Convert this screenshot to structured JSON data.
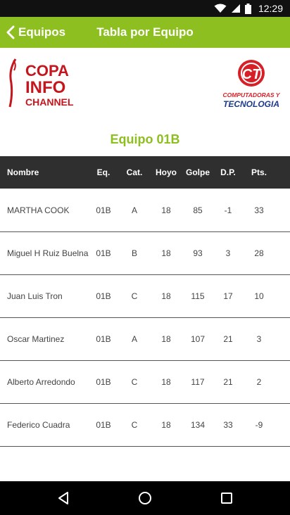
{
  "colors": {
    "accent": "#8cbf1f",
    "header_bg": "#2f2f2f",
    "status_bg": "#111111",
    "nav_bg": "#000000"
  },
  "statusbar": {
    "time": "12:29",
    "icons": [
      "wifi-icon",
      "signal-icon",
      "battery-icon"
    ]
  },
  "appbar": {
    "back_label": "Equipos",
    "title": "Tabla por Equipo"
  },
  "logos": {
    "left": {
      "lines": [
        "COPA",
        "INFO",
        "CHANNEL"
      ]
    },
    "right": {
      "mark": "CT",
      "lines": [
        "COMPUTADORAS Y",
        "TECNOLOGIA"
      ]
    }
  },
  "team_title": "Equipo 01B",
  "table": {
    "headers": {
      "name": "Nombre",
      "eq": "Eq.",
      "cat": "Cat.",
      "hoyo": "Hoyo",
      "golpe": "Golpe",
      "dp": "D.P.",
      "pts": "Pts."
    },
    "rows": [
      {
        "name": "MARTHA COOK",
        "eq": "01B",
        "cat": "A",
        "hoyo": "18",
        "golpe": "85",
        "dp": "-1",
        "pts": "33"
      },
      {
        "name": "Miguel H Ruiz Buelna",
        "eq": "01B",
        "cat": "B",
        "hoyo": "18",
        "golpe": "93",
        "dp": "3",
        "pts": "28"
      },
      {
        "name": "Juan Luis Tron",
        "eq": "01B",
        "cat": "C",
        "hoyo": "18",
        "golpe": "115",
        "dp": "17",
        "pts": "10"
      },
      {
        "name": "Oscar Martinez",
        "eq": "01B",
        "cat": "A",
        "hoyo": "18",
        "golpe": "107",
        "dp": "21",
        "pts": "3"
      },
      {
        "name": "Alberto Arredondo",
        "eq": "01B",
        "cat": "C",
        "hoyo": "18",
        "golpe": "117",
        "dp": "21",
        "pts": "2"
      },
      {
        "name": "Federico Cuadra",
        "eq": "01B",
        "cat": "C",
        "hoyo": "18",
        "golpe": "134",
        "dp": "33",
        "pts": "-9"
      }
    ]
  },
  "navbar": {
    "buttons": [
      "back-icon",
      "home-icon",
      "recents-icon"
    ]
  }
}
